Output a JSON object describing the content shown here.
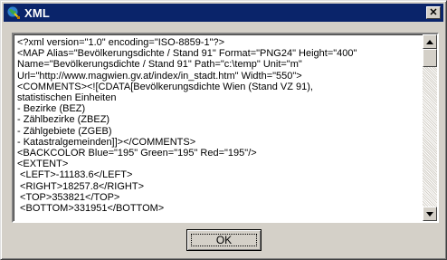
{
  "window": {
    "title": "XML",
    "app_icon": "globe-icon",
    "close_glyph": "✕"
  },
  "xml_text": "<?xml version=\"1.0\" encoding=\"ISO-8859-1\"?>\n<MAP Alias=\"Bevölkerungsdichte / Stand 91\" Format=\"PNG24\" Height=\"400\"\nName=\"Bevölkerungsdichte / Stand 91\" Path=\"c:\\temp\" Unit=\"m\"\nUrl=\"http://www.magwien.gv.at/index/in_stadt.htm\" Width=\"550\">\n<COMMENTS><![CDATA[Bevölkerungsdichte Wien (Stand VZ 91),\nstatistischen Einheiten\n- Bezirke (BEZ)\n- Zählbezirke (ZBEZ)\n- Zählgebiete (ZGEB)\n- Katastralgemeinden]]></COMMENTS>\n<BACKCOLOR Blue=\"195\" Green=\"195\" Red=\"195\"/>\n<EXTENT>\n <LEFT>-11183.6</LEFT>\n <RIGHT>18257.8</RIGHT>\n <TOP>353821</TOP>\n <BOTTOM>331951</BOTTOM>",
  "scroll": {
    "up_icon": "arrow-up-icon",
    "down_icon": "arrow-down-icon",
    "position": 0.0
  },
  "buttons": {
    "ok_label": "OK"
  },
  "colors": {
    "titlebar": "#0a246a",
    "face": "#d4d0c8"
  }
}
